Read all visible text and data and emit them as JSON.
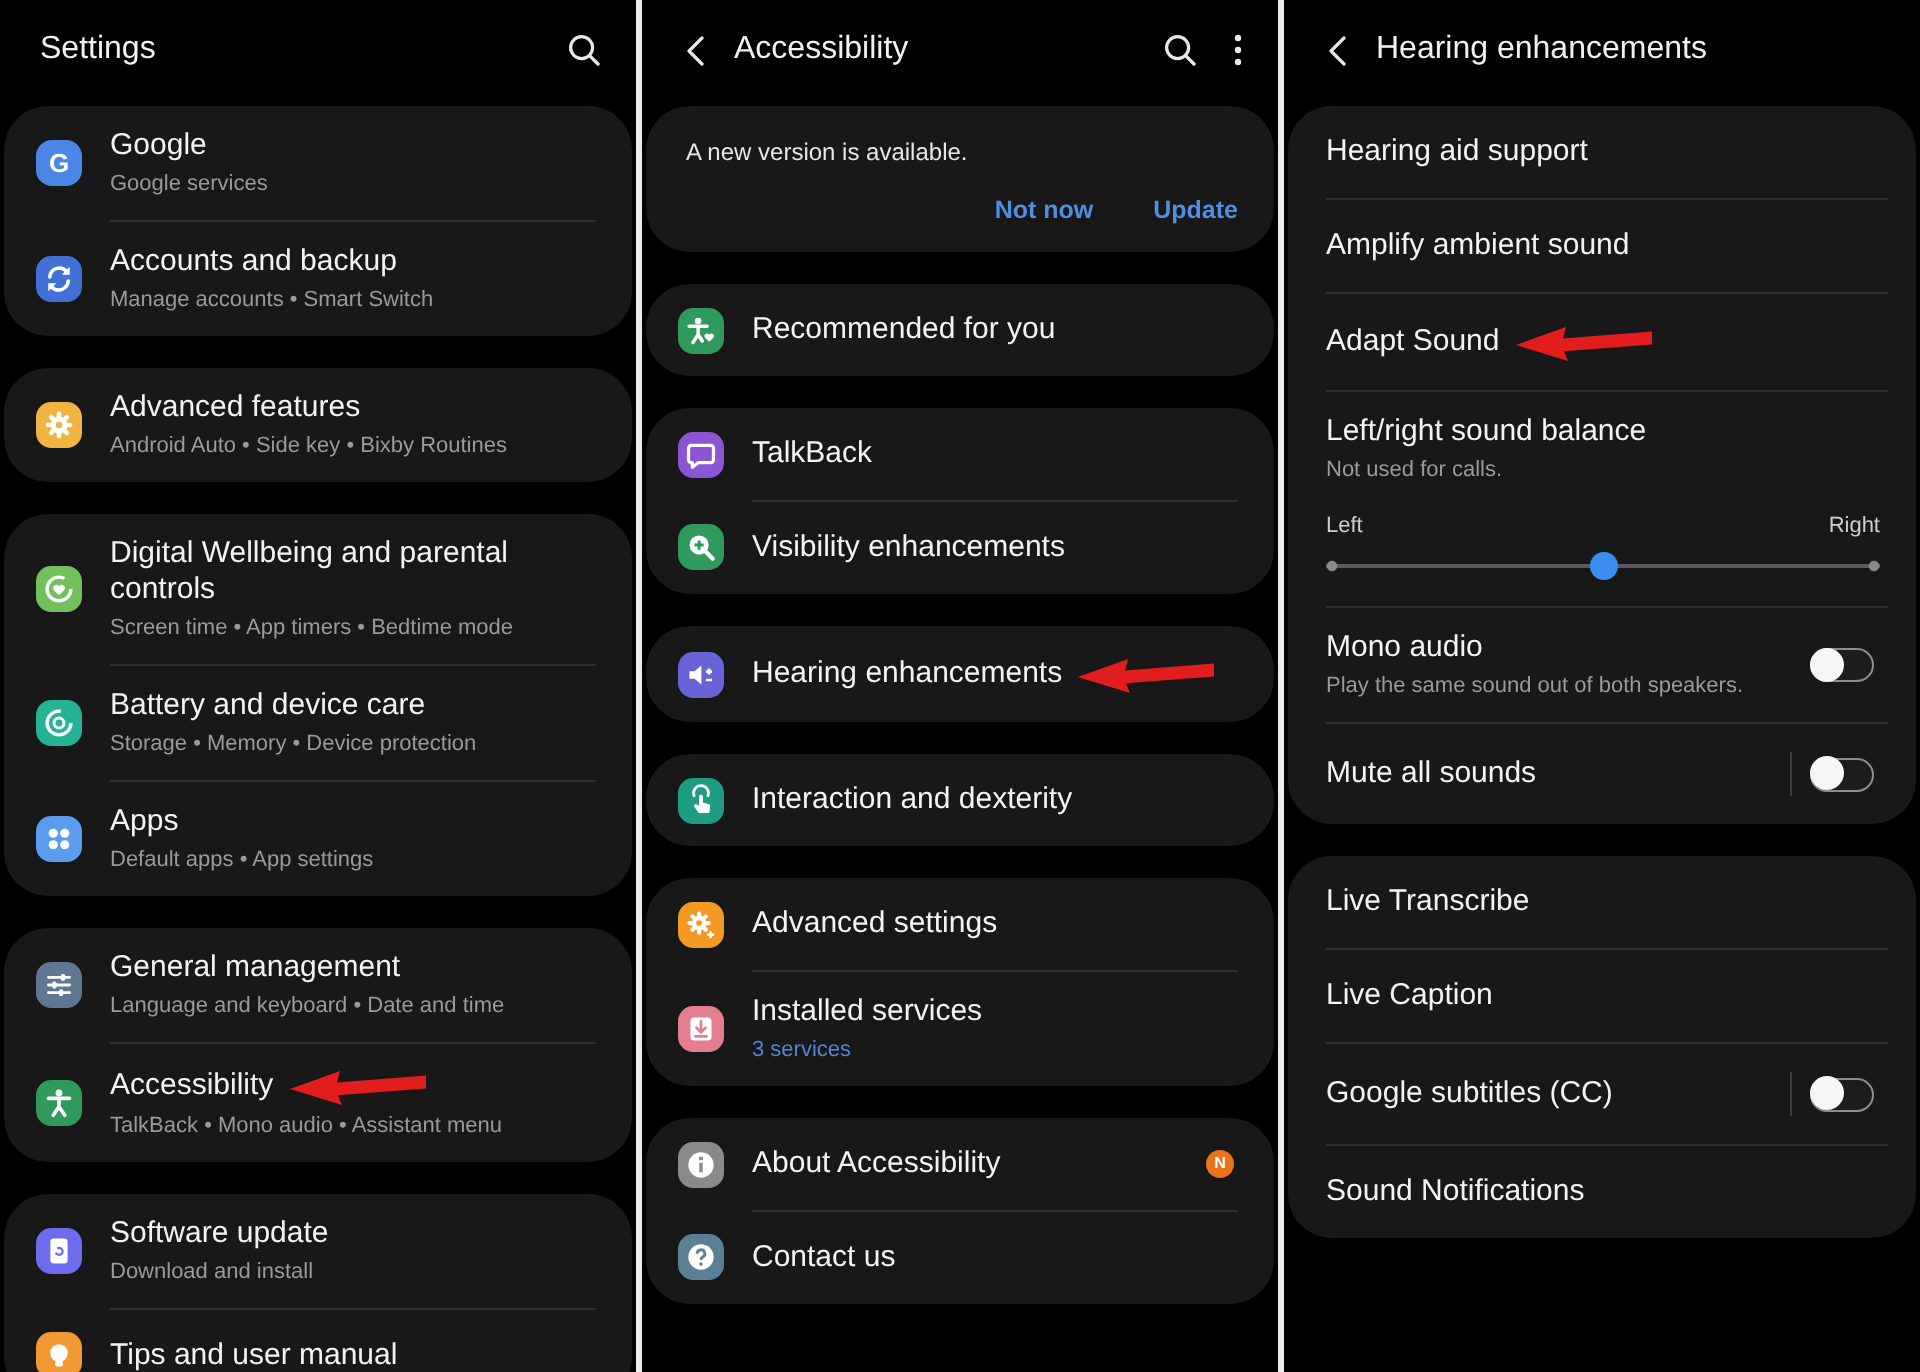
{
  "screens": [
    {
      "title": "Settings",
      "search_button": true,
      "groups": [
        {
          "items": [
            {
              "kind": "link",
              "title": "Google",
              "subtitle": "Google services",
              "color": "#4b87e6",
              "icon_letter": "G"
            },
            {
              "kind": "link",
              "title": "Accounts and backup",
              "subtitle": "Manage accounts • Smart Switch",
              "color": "#4370d6"
            }
          ]
        },
        {
          "items": [
            {
              "kind": "link",
              "title": "Advanced features",
              "subtitle": "Android Auto • Side key • Bixby Routines",
              "color": "#f2b441"
            }
          ]
        },
        {
          "items": [
            {
              "kind": "link",
              "title": "Digital Wellbeing and parental controls",
              "subtitle": "Screen time • App timers • Bedtime mode",
              "color": "#72bf5c"
            },
            {
              "kind": "link",
              "title": "Battery and device care",
              "subtitle": "Storage • Memory • Device protection",
              "color": "#24b394"
            },
            {
              "kind": "link",
              "title": "Apps",
              "subtitle": "Default apps • App settings",
              "color": "#5b9cef"
            }
          ]
        },
        {
          "items": [
            {
              "kind": "link",
              "title": "General management",
              "subtitle": "Language and keyboard • Date and time",
              "color": "#5e7891"
            },
            {
              "kind": "link",
              "title": "Accessibility",
              "subtitle": "TalkBack • Mono audio • Assistant menu",
              "color": "#2f9a5c",
              "annotated": true
            }
          ]
        },
        {
          "items": [
            {
              "kind": "link",
              "title": "Software update",
              "subtitle": "Download and install",
              "color": "#6c6cec"
            },
            {
              "kind": "link",
              "title": "Tips and user manual",
              "color": "#f19a34"
            }
          ]
        }
      ]
    },
    {
      "title": "Accessibility",
      "back_button": true,
      "search_button": true,
      "more_button": true,
      "banner": {
        "message": "A new version is available.",
        "actions": [
          "Not now",
          "Update"
        ]
      },
      "groups": [
        {
          "items": [
            {
              "kind": "link",
              "title": "Recommended for you",
              "color": "#2f9a5c"
            }
          ]
        },
        {
          "items": [
            {
              "kind": "link",
              "title": "TalkBack",
              "color": "#8b55d4"
            },
            {
              "kind": "link",
              "title": "Visibility enhancements",
              "color": "#2f9a5c"
            }
          ]
        },
        {
          "items": [
            {
              "kind": "link",
              "title": "Hearing enhancements",
              "color": "#6863d6",
              "annotated": true
            }
          ]
        },
        {
          "items": [
            {
              "kind": "link",
              "title": "Interaction and dexterity",
              "color": "#1e9c84"
            }
          ]
        },
        {
          "items": [
            {
              "kind": "link",
              "title": "Advanced settings",
              "color": "#f29a24"
            },
            {
              "kind": "link",
              "title": "Installed services",
              "subtitle": "3 services",
              "subtitle_accent": true,
              "color": "#e27e8e"
            }
          ]
        },
        {
          "items": [
            {
              "kind": "link",
              "title": "About Accessibility",
              "color": "#8a8a8a",
              "badge": "N"
            },
            {
              "kind": "link",
              "title": "Contact us",
              "color": "#5a8096"
            }
          ]
        }
      ]
    },
    {
      "title": "Hearing enhancements",
      "back_button": true,
      "groups": [
        {
          "items": [
            {
              "kind": "link",
              "title": "Hearing aid support"
            },
            {
              "kind": "link",
              "title": "Amplify ambient sound"
            },
            {
              "kind": "link",
              "title": "Adapt Sound",
              "annotated": true
            },
            {
              "kind": "slider",
              "title": "Left/right sound balance",
              "subtitle": "Not used for calls.",
              "slider": {
                "min_label": "Left",
                "max_label": "Right",
                "level": 0.5
              }
            },
            {
              "kind": "toggle",
              "title": "Mono audio",
              "subtitle": "Play the same sound out of both speakers.",
              "on": false
            },
            {
              "kind": "toggle",
              "title": "Mute all sounds",
              "on": false,
              "switch_divider": true
            }
          ]
        },
        {
          "items": [
            {
              "kind": "link",
              "title": "Live Transcribe"
            },
            {
              "kind": "link",
              "title": "Live Caption"
            },
            {
              "kind": "toggle",
              "title": "Google subtitles (CC)",
              "on": false,
              "switch_divider": true
            },
            {
              "kind": "link",
              "title": "Sound Notifications"
            }
          ]
        }
      ]
    }
  ]
}
